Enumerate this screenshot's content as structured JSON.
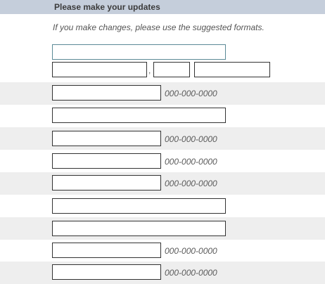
{
  "form": {
    "title": "Please make your updates",
    "instruction": "If you make changes, please use the suggested formats.",
    "comma": ",",
    "phone_placeholder_text": "000-000-0000",
    "fields": [
      {
        "value": "",
        "hint": ""
      },
      {
        "value": "",
        "hint": ""
      },
      {
        "value": "",
        "hint": ""
      },
      {
        "value": "",
        "hint": ""
      },
      {
        "value": "",
        "hint": "000-000-0000"
      },
      {
        "value": "",
        "hint": ""
      },
      {
        "value": "",
        "hint": "000-000-0000"
      },
      {
        "value": "",
        "hint": "000-000-0000"
      },
      {
        "value": "",
        "hint": "000-000-0000"
      },
      {
        "value": "",
        "hint": ""
      },
      {
        "value": "",
        "hint": ""
      },
      {
        "value": "",
        "hint": "000-000-0000"
      },
      {
        "value": "",
        "hint": "000-000-0000"
      }
    ]
  }
}
